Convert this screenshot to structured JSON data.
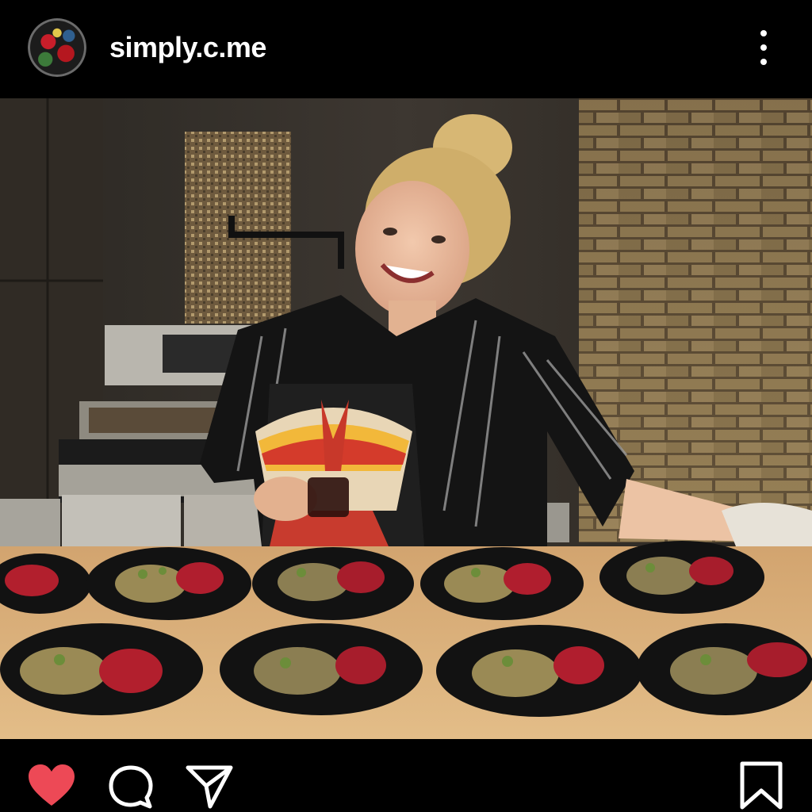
{
  "post": {
    "username": "simply.c.me",
    "avatar_icon": "profile-avatar",
    "more_icon": "more-vertical-icon"
  },
  "actions": {
    "like_icon": "heart-icon",
    "comment_icon": "comment-icon",
    "share_icon": "send-icon",
    "save_icon": "bookmark-icon",
    "like_color": "#ed4956"
  },
  "photo": {
    "description_icon": "post-photo"
  }
}
